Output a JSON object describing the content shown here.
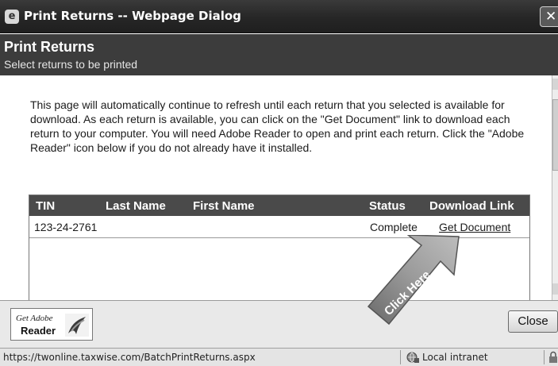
{
  "window": {
    "title": "Print Returns -- Webpage Dialog",
    "close_glyph": "✕"
  },
  "header": {
    "title": "Print Returns",
    "subtitle": "Select returns to be printed"
  },
  "intro_text": "This page will automatically continue to refresh until each return that you selected is available for download.  As each return is available, you can click on the \"Get Document\" link to download each return to your computer.  You will need Adobe Reader to open and print each return.  Click the \"Adobe Reader\" icon below if you do not already have it installed.",
  "table": {
    "columns": [
      "TIN",
      "Last Name",
      "First Name",
      "Status",
      "Download Link"
    ],
    "rows": [
      {
        "tin": "123-24-2761",
        "last_name": "",
        "first_name": "",
        "status": "Complete",
        "link": "Get Document"
      }
    ]
  },
  "annotation": {
    "text": "Click Here"
  },
  "footer": {
    "adobe_get": "Get Adobe",
    "adobe_reader": "Reader",
    "close_label": "Close"
  },
  "statusbar": {
    "url": "https://twonline.taxwise.com/BatchPrintReturns.aspx",
    "zone": "Local intranet"
  },
  "icons": {
    "window": "ie-page-icon",
    "zone": "intranet-globe-icon",
    "lock": "lock-icon"
  }
}
